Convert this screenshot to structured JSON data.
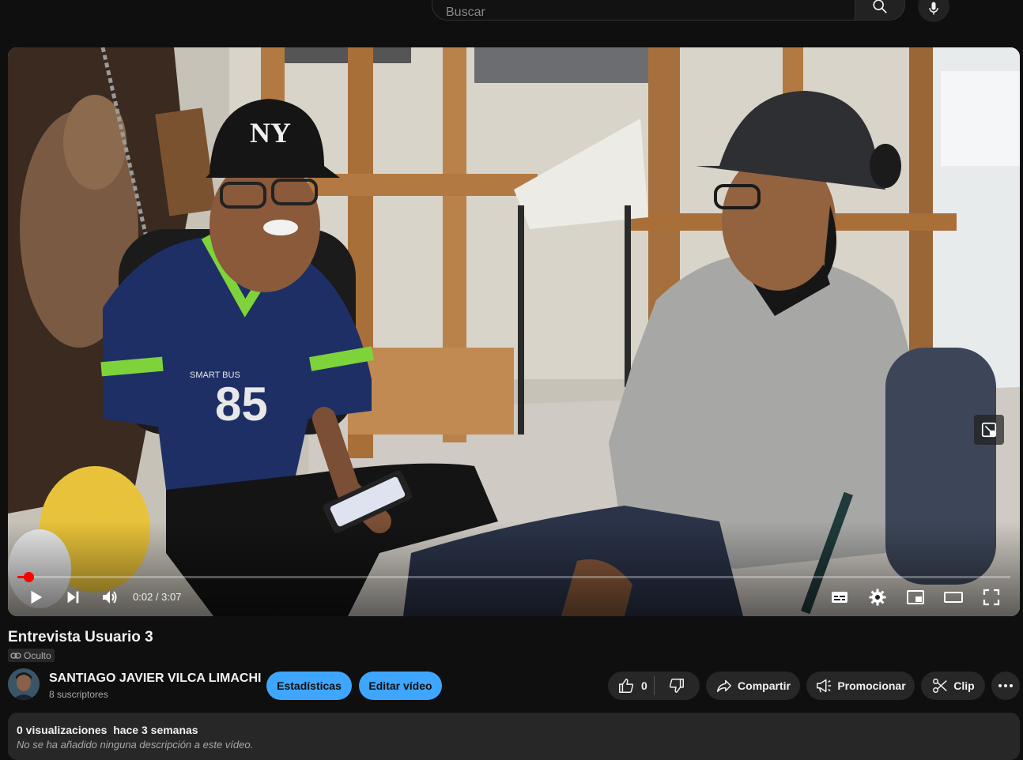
{
  "search": {
    "placeholder": "Buscar"
  },
  "player": {
    "progress_fraction": 0.011,
    "time_current": "0:02",
    "time_separator": " / ",
    "time_total": "3:07"
  },
  "scene": {
    "jersey_number": "85",
    "jersey_text": "SMART BUS"
  },
  "video": {
    "title": "Entrevista Usuario 3",
    "privacy": "Oculto"
  },
  "channel": {
    "name": "SANTIAGO JAVIER VILCA LIMACHI",
    "subscribers": "8 suscriptores"
  },
  "actions": {
    "stats_label": "Estadísticas",
    "edit_label": "Editar vídeo",
    "like_count": "0",
    "share_label": "Compartir",
    "promote_label": "Promocionar",
    "clip_label": "Clip"
  },
  "description": {
    "views": "0 visualizaciones",
    "date": "hace 3 semanas",
    "text": "No se ha añadido ninguna descripción a este vídeo."
  },
  "colors": {
    "background": "#0f0f0f",
    "accent_blue": "#3ea6ff",
    "progress_red": "#ff0000",
    "button_dark": "#272727"
  },
  "icons": [
    "search-icon",
    "mic-icon",
    "play-icon",
    "next-icon",
    "volume-icon",
    "miniplayer-expand-icon",
    "subtitles-icon",
    "settings-icon",
    "miniplayer-icon",
    "theater-icon",
    "fullscreen-icon",
    "link-icon",
    "like-icon",
    "dislike-icon",
    "share-icon",
    "promote-icon",
    "clip-icon",
    "more-icon"
  ]
}
